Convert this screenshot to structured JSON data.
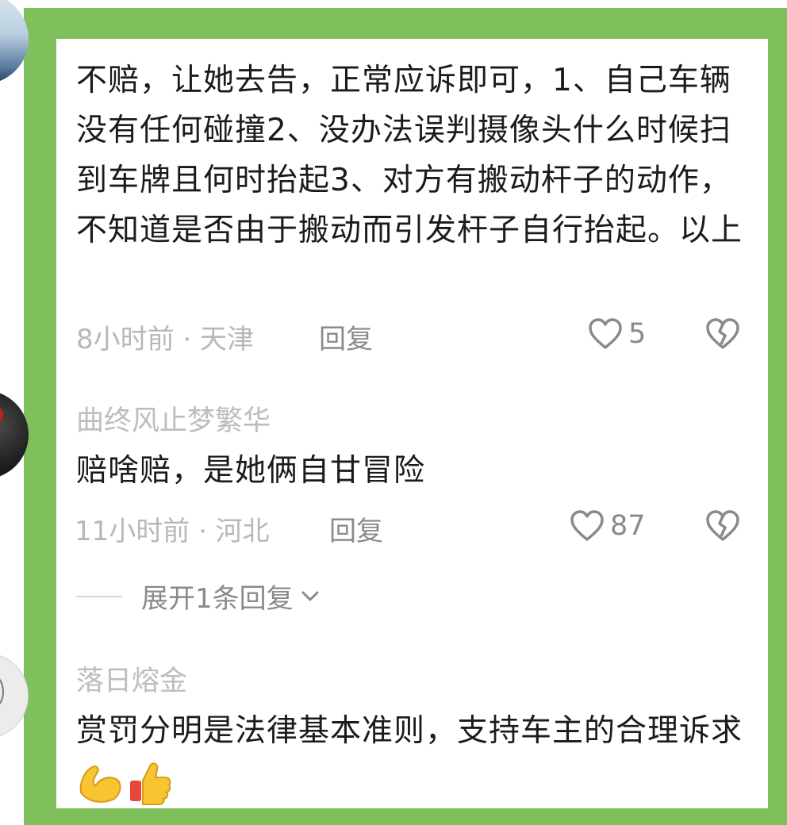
{
  "comments": [
    {
      "text": "不赔，让她去告，正常应诉即可，1、自己车辆没有任何碰撞2、没办法误判摄像头什么时候扫到车牌且何时抬起3、对方有搬动杆子的动作，不知道是否由于搬动而引发杆子自行抬起。以上",
      "meta": "8小时前 · 天津",
      "reply": "回复",
      "likes": "5"
    },
    {
      "username": "曲终风止梦繁华",
      "text": "赔啥赔，是她俩自甘冒险",
      "meta": "11小时前 · 河北",
      "reply": "回复",
      "likes": "87",
      "expand": "展开1条回复"
    },
    {
      "username": "落日熔金",
      "text": "赏罚分明是法律基本准则，支持车主的合理诉求"
    }
  ],
  "colors": {
    "frame": "#7fbf5c",
    "text": "#1b1b1b",
    "muted": "#b8b8b8"
  },
  "icons": [
    "heart-icon",
    "broken-heart-icon",
    "chevron-down-icon",
    "flexed-biceps-emoji",
    "thumbs-up-emoji"
  ]
}
